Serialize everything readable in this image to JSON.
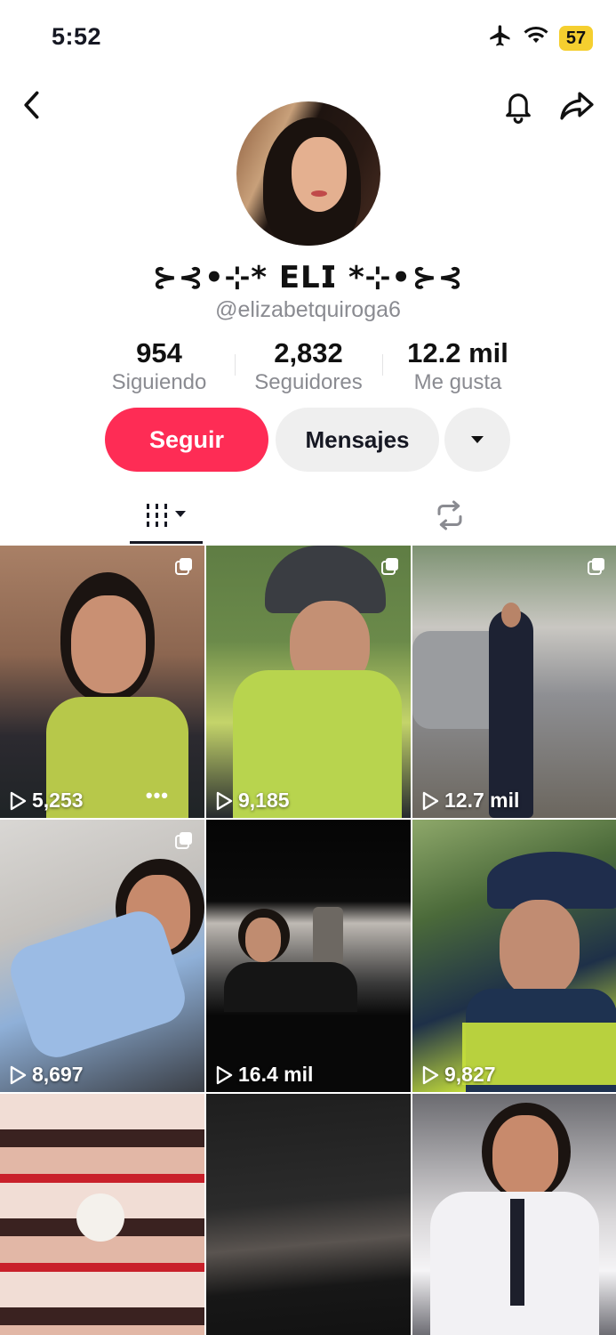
{
  "status_bar": {
    "time": "5:52",
    "battery": "57",
    "icons": [
      "airplane-icon",
      "wifi-icon",
      "battery-icon"
    ]
  },
  "nav": {
    "back_icon": "chevron-left-icon",
    "bell_icon": "bell-icon",
    "share_icon": "share-icon"
  },
  "profile": {
    "display_name": "⊱⊰•⊹* 𝗘𝗟𝗜 *⊹•⊱⊰",
    "username": "@elizabetquiroga6"
  },
  "stats": [
    {
      "value": "954",
      "label": "Siguiendo"
    },
    {
      "value": "2,832",
      "label": "Seguidores"
    },
    {
      "value": "12.2 mil",
      "label": "Me gusta"
    }
  ],
  "actions": {
    "follow": "Seguir",
    "message": "Mensajes",
    "more_icon": "caret-down-icon",
    "follow_color": "#fe2c55"
  },
  "tabs": [
    {
      "icon": "videos-grid-icon",
      "active": true
    },
    {
      "icon": "repost-icon",
      "active": false
    }
  ],
  "videos": [
    {
      "views": "5,253",
      "multi": true,
      "more": "•••"
    },
    {
      "views": "9,185",
      "multi": true
    },
    {
      "views": "12.7 mil",
      "multi": true
    },
    {
      "views": "8,697",
      "multi": true
    },
    {
      "views": "16.4 mil",
      "multi": false
    },
    {
      "views": "9,827",
      "multi": false
    },
    {
      "views": "",
      "multi": false
    },
    {
      "views": "",
      "multi": false
    },
    {
      "views": "",
      "multi": false
    }
  ]
}
